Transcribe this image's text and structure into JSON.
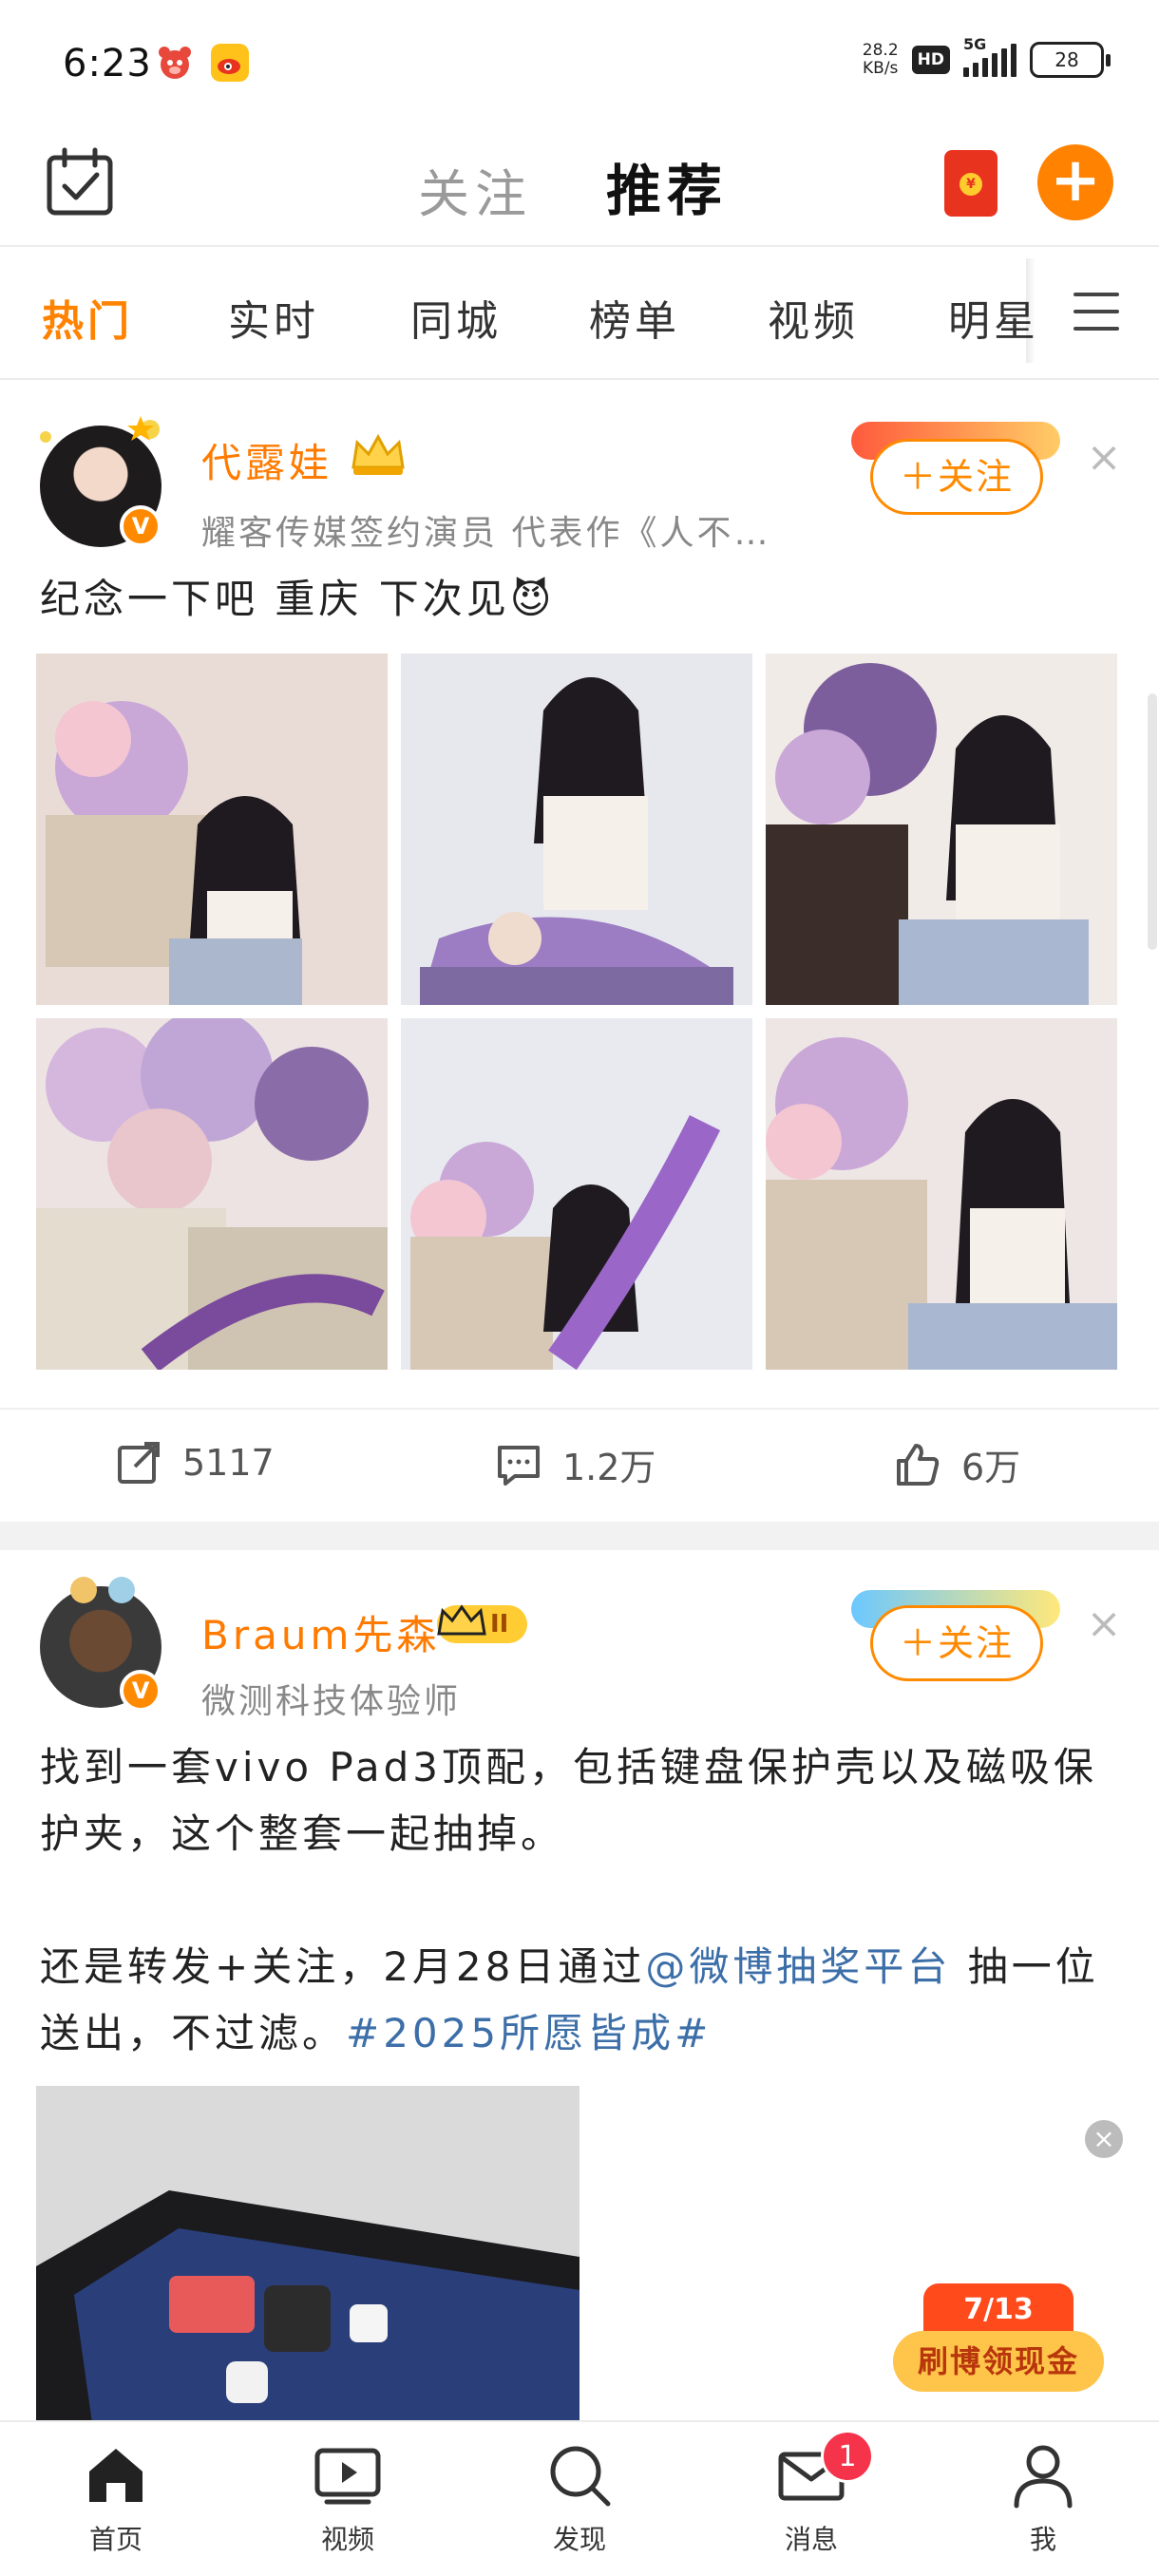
{
  "status_bar": {
    "time": "6:23",
    "net_speed_value": "28.2",
    "net_speed_unit": "KB/s",
    "hd": "HD",
    "network": "5G",
    "battery": "28"
  },
  "header": {
    "tab_follow": "关注",
    "tab_recommend": "推荐",
    "redpacket_coin": "¥",
    "add_symbol": "+"
  },
  "channels": [
    "热门",
    "实时",
    "同城",
    "榜单",
    "视频",
    "明星"
  ],
  "posts": [
    {
      "username": "代露娃",
      "description": "耀客传媒签约演员 代表作《人不…",
      "follow_label": "＋关注",
      "verified": "V",
      "text": "纪念一下吧 重庆 下次见😈",
      "actions": {
        "repost": "5117",
        "comment": "1.2万",
        "like": "6万"
      }
    },
    {
      "username": "Braum先森",
      "description": "微测科技体验师",
      "follow_label": "＋关注",
      "verified": "V",
      "level": "II",
      "text_line1": "找到一套vivo Pad3顶配，包括键盘保护壳以及磁吸保",
      "text_line2": "护夹，这个整套一起抽掉。",
      "text_line3_pre": "还是转发+关注，2月28日通过",
      "mention": "@微博抽奖平台",
      "text_line3_post": " 抽一位",
      "text_line4_pre": "送出，不过滤。",
      "hashtag": "#2025所愿皆成#"
    }
  ],
  "reward_float": {
    "count": "7/13",
    "label": "刷博领现金"
  },
  "bottom_nav": [
    {
      "label": "首页",
      "icon": "home-icon"
    },
    {
      "label": "视频",
      "icon": "video-icon"
    },
    {
      "label": "发现",
      "icon": "search-icon"
    },
    {
      "label": "消息",
      "icon": "mail-icon",
      "badge": "1"
    },
    {
      "label": "我",
      "icon": "profile-icon"
    }
  ],
  "colors": {
    "accent": "#ff8200",
    "link": "#3c6ea8",
    "badge_red": "#f5334a"
  }
}
